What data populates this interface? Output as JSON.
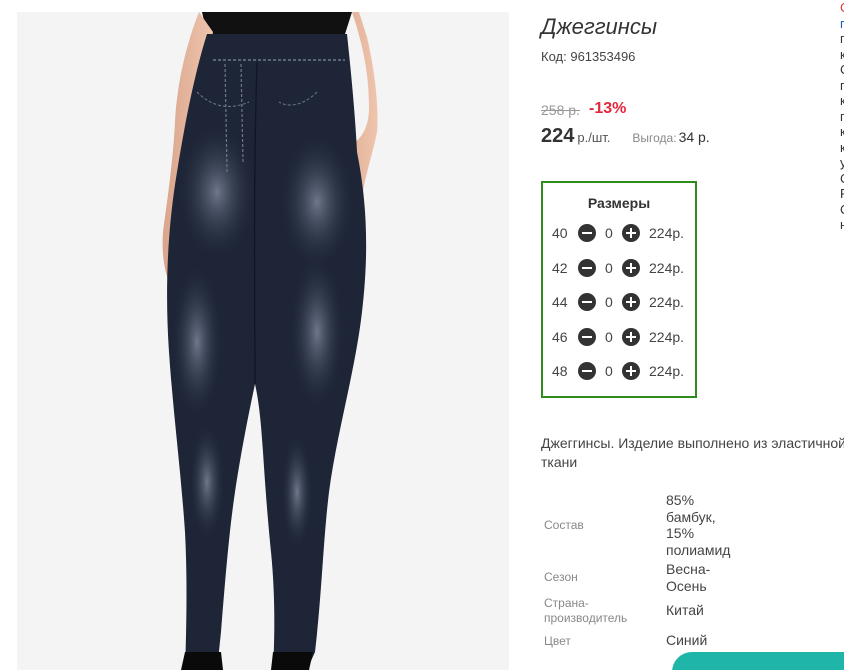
{
  "product": {
    "title": "Джеггинсы",
    "code_label": "Код:",
    "code_value": "961353496",
    "old_price": "258 р.",
    "discount": "-13%",
    "price": "224",
    "price_unit": "р./шт.",
    "benefit_label": "Выгода:",
    "benefit_value": "34 р."
  },
  "sizes": {
    "title": "Размеры",
    "rows": [
      {
        "size": "40",
        "qty": "0",
        "price": "224р."
      },
      {
        "size": "42",
        "qty": "0",
        "price": "224р."
      },
      {
        "size": "44",
        "qty": "0",
        "price": "224р."
      },
      {
        "size": "46",
        "qty": "0",
        "price": "224р."
      },
      {
        "size": "48",
        "qty": "0",
        "price": "224р."
      }
    ]
  },
  "description": "Джеггинсы. Изделие выполнено из эластичной ткани",
  "properties": [
    {
      "label": "Состав",
      "value": "85% бамбук, 15% полиамид"
    },
    {
      "label": "Сезон",
      "value": "Весна-Осень"
    },
    {
      "label": "Страна-производитель",
      "value": "Китай"
    },
    {
      "label": "Цвет",
      "value": "Синий"
    }
  ],
  "side_links": [
    "С",
    "п",
    "п",
    "к",
    "С",
    "п",
    "к",
    "п",
    "к",
    "к",
    "у",
    "С",
    "Р",
    "С",
    "н"
  ],
  "colors": {
    "accent_red": "#e5263c",
    "sizes_border": "#2e8b1e",
    "teal": "#1fb5a9",
    "denim": "#1d2536"
  }
}
